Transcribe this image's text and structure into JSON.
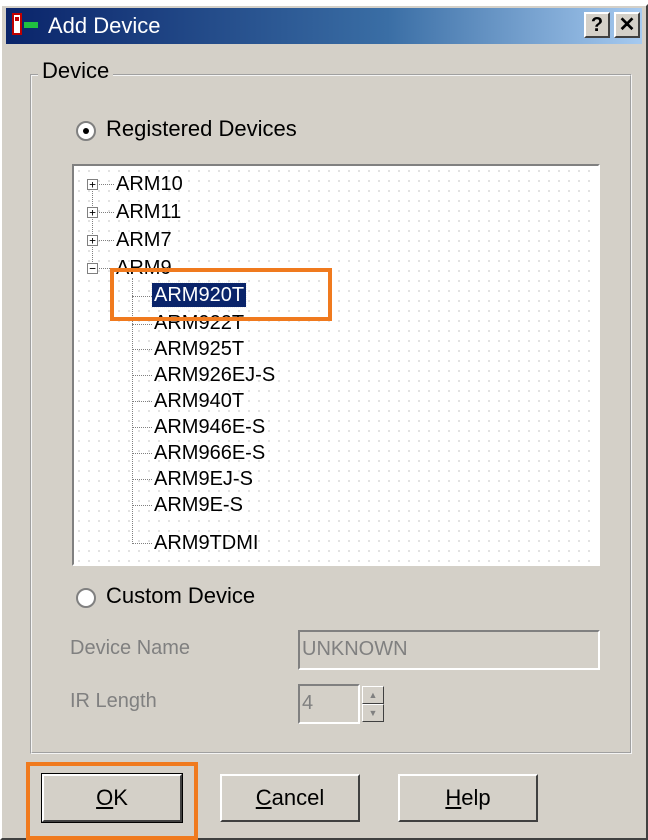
{
  "window": {
    "title": "Add Device",
    "help_button": "?",
    "close_button": "✕"
  },
  "device_group": {
    "legend": "Device",
    "registered_label": "Registered Devices",
    "custom_label": "Custom Device",
    "selected_option": "Registered Devices"
  },
  "tree": {
    "top_nodes": [
      {
        "label": "ARM10",
        "expanded": false
      },
      {
        "label": "ARM11",
        "expanded": false
      },
      {
        "label": "ARM7",
        "expanded": false
      },
      {
        "label": "ARM9",
        "expanded": true
      }
    ],
    "arm9_children": [
      "ARM920T",
      "ARM922T",
      "ARM925T",
      "ARM926EJ-S",
      "ARM940T",
      "ARM946E-S",
      "ARM966E-S",
      "ARM9EJ-S",
      "ARM9E-S",
      "ARM9TDMI"
    ],
    "selected": "ARM920T"
  },
  "custom_fields": {
    "device_name_label": "Device Name",
    "device_name_value": "UNKNOWN",
    "ir_length_label": "IR Length",
    "ir_length_value": "4"
  },
  "buttons": {
    "ok_underlined": "O",
    "ok_rest": "K",
    "cancel_underlined": "C",
    "cancel_rest": "ancel",
    "help_underlined": "H",
    "help_rest": "elp"
  },
  "colors": {
    "title_bar": "#0a246a",
    "selection": "#0a246a",
    "highlight_annotation": "#f07a1e"
  }
}
